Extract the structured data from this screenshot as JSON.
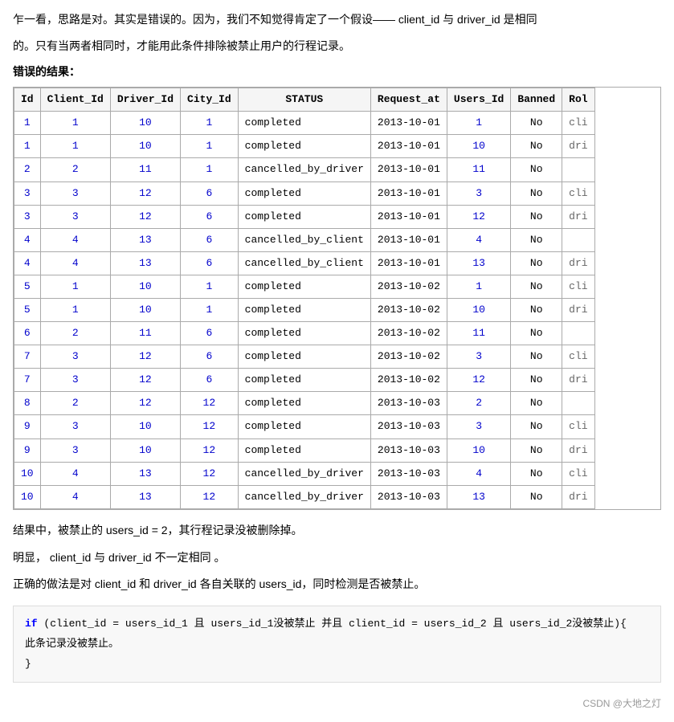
{
  "intro": {
    "line1": "乍一看，思路是对。其实是错误的。因为，我们不知觉得肯定了一个假设—— client_id 与 driver_id 是相同",
    "line2": "的。只有当两者相同时，才能用此条件排除被禁止用户的行程记录。",
    "error_label": "错误的结果："
  },
  "table": {
    "headers": [
      "Id",
      "Client_Id",
      "Driver_Id",
      "City_Id",
      "STATUS",
      "Request_at",
      "Users_Id",
      "Banned",
      "Rol"
    ],
    "rows": [
      [
        "1",
        "1",
        "10",
        "1",
        "completed",
        "2013-10-01",
        "1",
        "No",
        "cli"
      ],
      [
        "1",
        "1",
        "10",
        "1",
        "completed",
        "2013-10-01",
        "10",
        "No",
        "dri"
      ],
      [
        "2",
        "2",
        "11",
        "1",
        "cancelled_by_driver",
        "2013-10-01",
        "11",
        "No",
        ""
      ],
      [
        "3",
        "3",
        "12",
        "6",
        "completed",
        "2013-10-01",
        "3",
        "No",
        "cli"
      ],
      [
        "3",
        "3",
        "12",
        "6",
        "completed",
        "2013-10-01",
        "12",
        "No",
        "dri"
      ],
      [
        "4",
        "4",
        "13",
        "6",
        "cancelled_by_client",
        "2013-10-01",
        "4",
        "No",
        ""
      ],
      [
        "4",
        "4",
        "13",
        "6",
        "cancelled_by_client",
        "2013-10-01",
        "13",
        "No",
        "dri"
      ],
      [
        "5",
        "1",
        "10",
        "1",
        "completed",
        "2013-10-02",
        "1",
        "No",
        "cli"
      ],
      [
        "5",
        "1",
        "10",
        "1",
        "completed",
        "2013-10-02",
        "10",
        "No",
        "dri"
      ],
      [
        "6",
        "2",
        "11",
        "6",
        "completed",
        "2013-10-02",
        "11",
        "No",
        ""
      ],
      [
        "7",
        "3",
        "12",
        "6",
        "completed",
        "2013-10-02",
        "3",
        "No",
        "cli"
      ],
      [
        "7",
        "3",
        "12",
        "6",
        "completed",
        "2013-10-02",
        "12",
        "No",
        "dri"
      ],
      [
        "8",
        "2",
        "12",
        "12",
        "completed",
        "2013-10-03",
        "2",
        "No",
        ""
      ],
      [
        "9",
        "3",
        "10",
        "12",
        "completed",
        "2013-10-03",
        "3",
        "No",
        "cli"
      ],
      [
        "9",
        "3",
        "10",
        "12",
        "completed",
        "2013-10-03",
        "10",
        "No",
        "dri"
      ],
      [
        "10",
        "4",
        "13",
        "12",
        "cancelled_by_driver",
        "2013-10-03",
        "4",
        "No",
        "cli"
      ],
      [
        "10",
        "4",
        "13",
        "12",
        "cancelled_by_driver",
        "2013-10-03",
        "13",
        "No",
        "dri"
      ]
    ]
  },
  "result_text": "结果中，被禁止的 users_id = 2，其行程记录没被删除掉。",
  "obvious_text": "明显，  client_id 与 driver_id 不一定相同 。",
  "correct_text": "正确的做法是对 client_id 和 driver_id 各自关联的 users_id，同时检测是否被禁止。",
  "code": {
    "line1": "if (client_id = users_id_1 且 users_id_1没被禁止 并且 client_id = users_id_2 且 users_id_2没被禁止){",
    "line2": "    此条记录没被禁止。",
    "line3": "}"
  },
  "footer": "CSDN @大地之灯"
}
